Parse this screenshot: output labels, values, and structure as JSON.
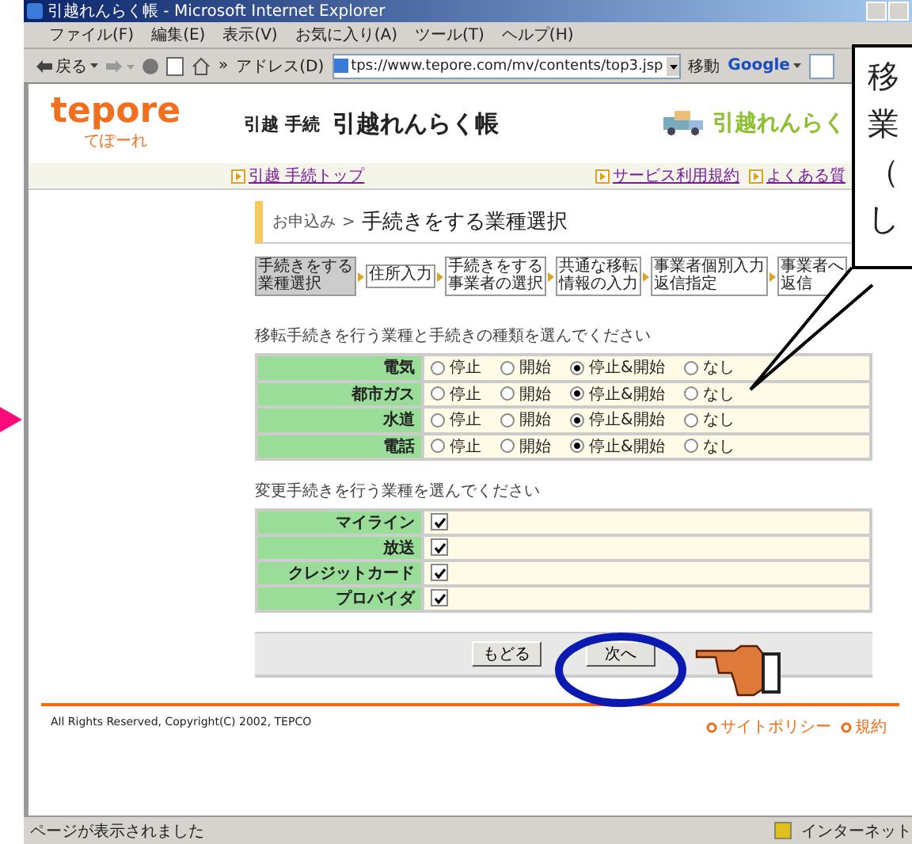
{
  "window": {
    "title": "引越れんらく帳 - Microsoft Internet Explorer"
  },
  "menu": [
    "ファイル(F)",
    "編集(E)",
    "表示(V)",
    "お気に入り(A)",
    "ツール(T)",
    "ヘルプ(H)"
  ],
  "toolbar": {
    "back": "戻る",
    "chevron": "»",
    "address_label": "アドレス(D)",
    "address": "tps://www.tepore.com/mv/contents/top3.jsp",
    "go": "移動",
    "google": "Google"
  },
  "page": {
    "logo": "tepore",
    "logo_sub": "てぽーれ",
    "site_label": "引越 手続",
    "site_title": "引越れんらく帳",
    "banner": "引越れんらく",
    "nav": [
      "引越 手続トップ",
      "サービス利用規約",
      "よくある質"
    ],
    "breadcrumb": "お申込み",
    "breadcrumb_sep": ">",
    "heading": "手続きをする業種選択",
    "steps": [
      {
        "lines": [
          "手続きをする",
          "業種選択"
        ],
        "selected": true
      },
      {
        "lines": [
          "住所入力"
        ],
        "selected": false
      },
      {
        "lines": [
          "手続きをする",
          "事業者の選択"
        ],
        "selected": false
      },
      {
        "lines": [
          "共通な移転",
          "情報の入力"
        ],
        "selected": false
      },
      {
        "lines": [
          "事業者個別入力",
          "返信指定"
        ],
        "selected": false
      },
      {
        "lines": [
          "事業者へ",
          "返信"
        ],
        "selected": false
      }
    ],
    "section1": "移転手続きを行う業種と手続きの種類を選んでください",
    "transfer_rows": [
      {
        "name": "電気",
        "options": [
          {
            "label": "停止",
            "selected": false
          },
          {
            "label": "開始",
            "selected": false
          },
          {
            "label": "停止&開始",
            "selected": true
          },
          {
            "label": "なし",
            "selected": false
          }
        ]
      },
      {
        "name": "都市ガス",
        "options": [
          {
            "label": "停止",
            "selected": false
          },
          {
            "label": "開始",
            "selected": false
          },
          {
            "label": "停止&開始",
            "selected": true
          },
          {
            "label": "なし",
            "selected": false
          }
        ]
      },
      {
        "name": "水道",
        "options": [
          {
            "label": "停止",
            "selected": false
          },
          {
            "label": "開始",
            "selected": false
          },
          {
            "label": "停止&開始",
            "selected": true
          },
          {
            "label": "なし",
            "selected": false
          }
        ]
      },
      {
        "name": "電話",
        "options": [
          {
            "label": "停止",
            "selected": false
          },
          {
            "label": "開始",
            "selected": false
          },
          {
            "label": "停止&開始",
            "selected": true
          },
          {
            "label": "なし",
            "selected": false
          }
        ]
      }
    ],
    "section2": "変更手続きを行う業種を選んでください",
    "change_rows": [
      {
        "name": "マイライン",
        "checked": true
      },
      {
        "name": "放送",
        "checked": true
      },
      {
        "name": "クレジットカード",
        "checked": true
      },
      {
        "name": "プロバイダ",
        "checked": true
      }
    ],
    "buttons": [
      "もどる",
      "次へ"
    ],
    "copyright": "All Rights Reserved, Copyright(C) 2002, TEPCO",
    "footer_links": [
      "サイトポリシー",
      "規約"
    ]
  },
  "status": {
    "text": "ページが表示されました",
    "zone": "インターネット"
  },
  "callout": [
    "移",
    "業",
    "（",
    "し"
  ]
}
